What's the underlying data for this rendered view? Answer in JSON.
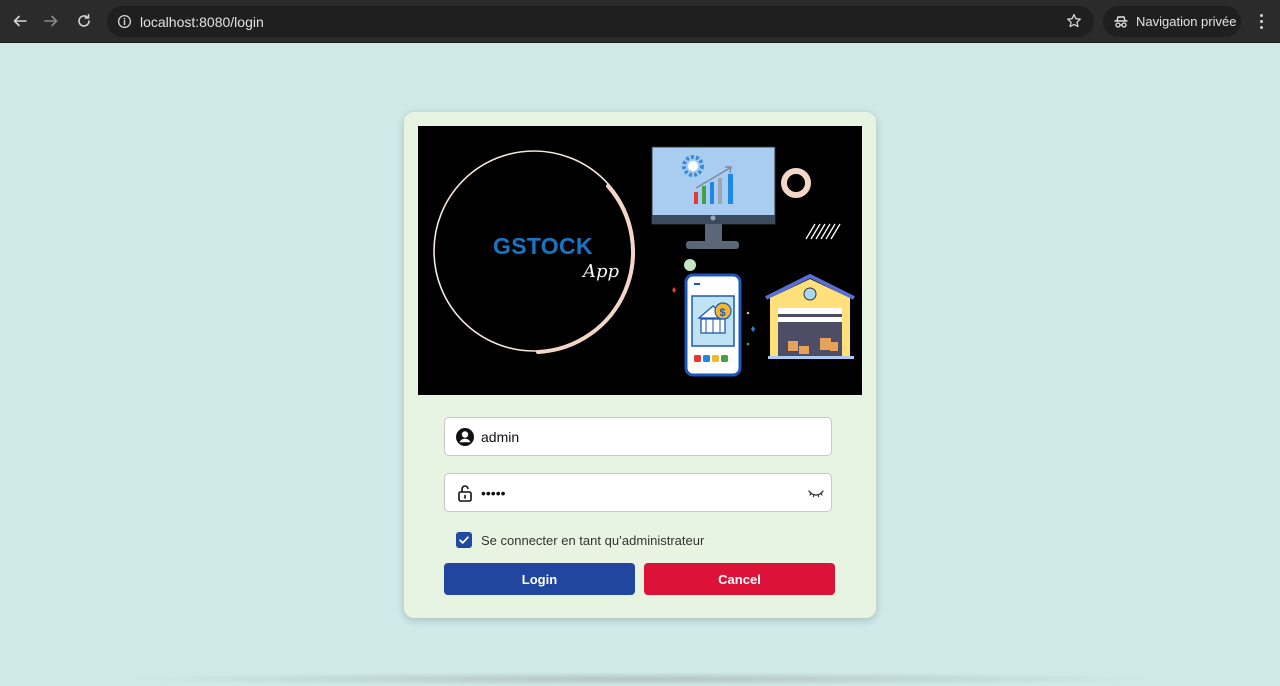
{
  "browser": {
    "url": "localhost:8080/login",
    "profile_label": "Navigation privée",
    "icons": {
      "back": "arrow-left-icon",
      "forward": "arrow-right-icon",
      "reload": "reload-icon",
      "info": "info-icon",
      "bookmark": "star-icon",
      "incognito": "incognito-icon",
      "menu": "kebab-menu-icon"
    }
  },
  "banner": {
    "brand": "GSTOCK",
    "brand_sub": "App"
  },
  "form": {
    "username": {
      "value": "admin",
      "icon": "user-icon"
    },
    "password": {
      "value": "•••••",
      "icon": "lock-icon",
      "toggle_icon": "eye-closed-icon"
    },
    "admin_checkbox": {
      "label": "Se connecter en tant qu’administrateur",
      "checked": true
    },
    "login_label": "Login",
    "cancel_label": "Cancel"
  },
  "colors": {
    "page_bg": "#cfe8e8",
    "card_bg": "#e8f4e2",
    "brand": "#1676c4",
    "login_button": "#2046a0",
    "cancel_button": "#dc1238"
  }
}
